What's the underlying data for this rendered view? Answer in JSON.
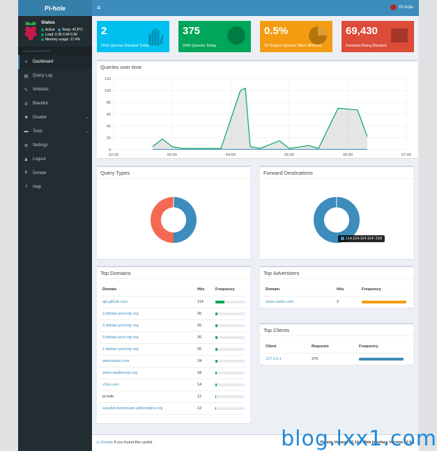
{
  "app": {
    "title": "Pi-hole",
    "user": "Pi-hole"
  },
  "status": {
    "title": "Status",
    "active": "Active",
    "temp": "Temp: 42.8°C",
    "load": "Load:  0.35  0.84  0.96",
    "memory": "Memory usage:  17.4%"
  },
  "sidebar": {
    "header": "MAIN NAVIGATION",
    "items": [
      {
        "label": "Dashboard",
        "icon": "home-icon",
        "glyph": "⌂"
      },
      {
        "label": "Query Log",
        "icon": "file-icon",
        "glyph": "▤"
      },
      {
        "label": "Whitelist",
        "icon": "pencil-icon",
        "glyph": "✎"
      },
      {
        "label": "Blacklist",
        "icon": "ban-icon",
        "glyph": "⊘"
      },
      {
        "label": "Disable",
        "icon": "stop-icon",
        "glyph": "■"
      },
      {
        "label": "Tools",
        "icon": "folder-icon",
        "glyph": "▬"
      },
      {
        "label": "Settings",
        "icon": "gears-icon",
        "glyph": "⚙"
      },
      {
        "label": "Logout",
        "icon": "user-icon",
        "glyph": "♟"
      },
      {
        "label": "Donate",
        "icon": "paypal-icon",
        "glyph": "P"
      },
      {
        "label": "Help",
        "icon": "question-icon",
        "glyph": "?"
      }
    ]
  },
  "stats": [
    {
      "value": "2",
      "label": "DNS Queries Blocked Today",
      "color": "#00c0ef",
      "icon": "hand-icon"
    },
    {
      "value": "375",
      "label": "DNS Queries Today",
      "color": "#00a65a",
      "icon": "globe-icon"
    },
    {
      "value": "0.5%",
      "label": "Of Today's Queries Were Blocked",
      "color": "#f39c12",
      "icon": "pie-icon"
    },
    {
      "value": "69,430",
      "label": "Domains Being Blocked",
      "color": "#dd4b39",
      "icon": "list-icon"
    }
  ],
  "queries_over_time": {
    "title": "Queries over time"
  },
  "query_types": {
    "title": "Query Types"
  },
  "forward_destinations": {
    "title": "Forward Destinations",
    "tooltip": "114.114.114.114: 218"
  },
  "top_domains": {
    "title": "Top Domains",
    "headers": [
      "Domain",
      "Hits",
      "Frequency"
    ],
    "rows": [
      {
        "domain": "api.github.com",
        "hits": "114",
        "freq": 0.3
      },
      {
        "domain": "2.debian.pool.ntp.org",
        "hits": "26",
        "freq": 0.07
      },
      {
        "domain": "3.debian.pool.ntp.org",
        "hits": "26",
        "freq": 0.07
      },
      {
        "domain": "0.debian.pool.ntp.org",
        "hits": "26",
        "freq": 0.07
      },
      {
        "domain": "1.debian.pool.ntp.org",
        "hits": "26",
        "freq": 0.07
      },
      {
        "domain": "www.baidu.com",
        "hits": "24",
        "freq": 0.065
      },
      {
        "domain": "www.raspberrypi.org",
        "hits": "18",
        "freq": 0.05
      },
      {
        "domain": "v2ex.com",
        "hits": "14",
        "freq": 0.04
      },
      {
        "domain": "pi.hole",
        "hits": "12",
        "freq": 0.03,
        "plain": true
      },
      {
        "domain": "easylist-downloads.adblockplus.org",
        "hits": "12",
        "freq": 0.03
      }
    ]
  },
  "top_advertisers": {
    "title": "Top Advertisers",
    "headers": [
      "Domain",
      "Hits",
      "Frequency"
    ],
    "rows": [
      {
        "domain": "union.baidu.com",
        "hits": "2",
        "freq": 1.0
      }
    ]
  },
  "top_clients": {
    "title": "Top Clients",
    "headers": [
      "Client",
      "Requests",
      "Frequency"
    ],
    "rows": [
      {
        "client": "127.0.0.1",
        "requests": "375",
        "freq": 1.0
      }
    ]
  },
  "footer": {
    "donate": "Donate",
    "donate_suffix": " if you found this useful.",
    "version": "Pi-hole Version v2.13.1 Web Interface Version v2.5.1"
  },
  "watermark": "blog.lxx1.com",
  "chart_data": [
    {
      "type": "area",
      "title": "Queries over time",
      "x": [
        "02:00",
        "02:30",
        "03:00",
        "03:30",
        "04:00",
        "04:30",
        "05:00",
        "05:30",
        "06:00",
        "06:30",
        "07:00"
      ],
      "ylim": [
        0,
        120
      ],
      "yticks": [
        0,
        20,
        40,
        60,
        80,
        100,
        120
      ],
      "xticks": [
        "02:00",
        "03:00",
        "04:00",
        "05:00",
        "06:00",
        "07:00"
      ],
      "grid": true,
      "series": [
        {
          "color": "#00a65a",
          "points": [
            [
              "02:40",
              5
            ],
            [
              "02:50",
              18
            ],
            [
              "03:00",
              5
            ],
            [
              "03:10",
              2
            ],
            [
              "03:30",
              2
            ],
            [
              "03:50",
              2
            ],
            [
              "04:10",
              100
            ],
            [
              "04:15",
              104
            ],
            [
              "04:20",
              5
            ],
            [
              "04:30",
              2
            ],
            [
              "04:50",
              15
            ],
            [
              "05:00",
              2
            ],
            [
              "05:20",
              7
            ],
            [
              "05:30",
              2
            ],
            [
              "05:50",
              70
            ],
            [
              "06:10",
              67
            ],
            [
              "06:20",
              22
            ]
          ]
        },
        {
          "color": "#3c8dbc",
          "points": [
            [
              "02:40",
              0
            ],
            [
              "06:20",
              0
            ]
          ]
        }
      ]
    },
    {
      "type": "pie",
      "title": "Query Types",
      "donut": true,
      "values": [
        0.5,
        0.5
      ],
      "colors": [
        "#3c8dbc",
        "#f56954"
      ]
    },
    {
      "type": "pie",
      "title": "Forward Destinations",
      "donut": true,
      "categories": [
        "114.114.114.114"
      ],
      "values": [
        218
      ],
      "colors": [
        "#3c8dbc"
      ]
    }
  ]
}
